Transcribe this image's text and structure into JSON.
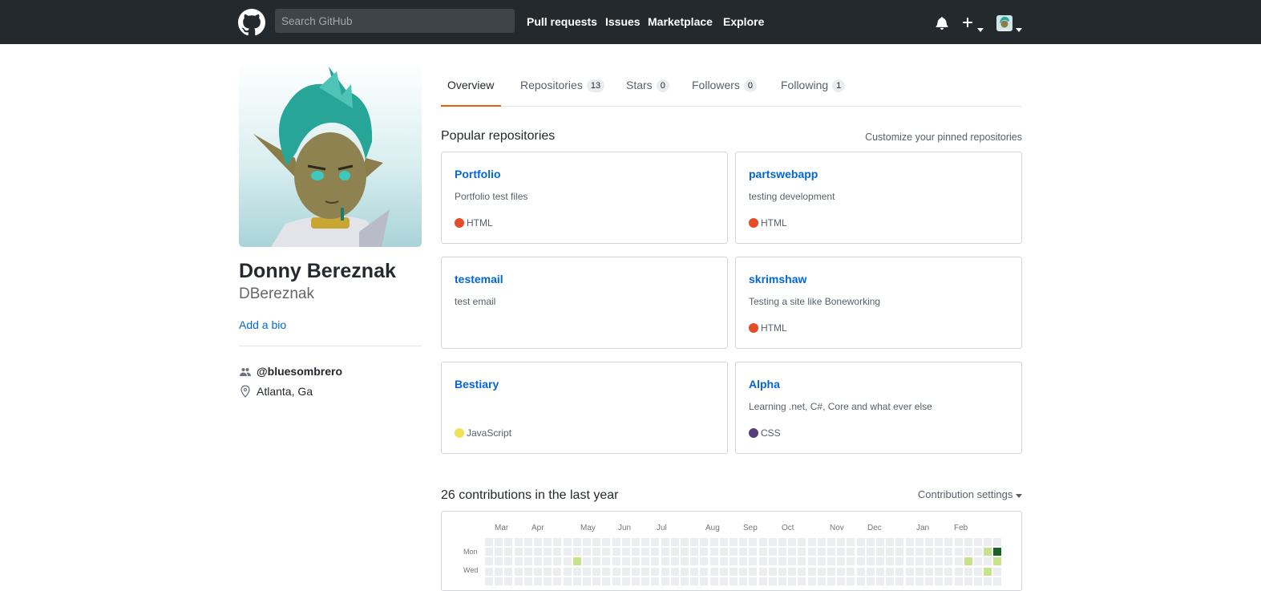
{
  "header": {
    "search_placeholder": "Search GitHub",
    "nav": [
      "Pull requests",
      "Issues",
      "Marketplace",
      "Explore"
    ],
    "icons": [
      "github-logo-icon",
      "bell-icon",
      "plus-icon",
      "chevron-down-icon",
      "avatar"
    ]
  },
  "profile": {
    "fullname": "Donny Bereznak",
    "username": "DBereznak",
    "add_bio": "Add a bio",
    "organization": "@bluesombrero",
    "location": "Atlanta, Ga"
  },
  "tabs": [
    {
      "label": "Overview",
      "count": null,
      "selected": true
    },
    {
      "label": "Repositories",
      "count": "13",
      "selected": false
    },
    {
      "label": "Stars",
      "count": "0",
      "selected": false
    },
    {
      "label": "Followers",
      "count": "0",
      "selected": false
    },
    {
      "label": "Following",
      "count": "1",
      "selected": false
    }
  ],
  "pinned": {
    "title": "Popular repositories",
    "customize": "Customize your pinned repositories",
    "repos": [
      {
        "name": "Portfolio",
        "description": "Portfolio test files",
        "language": "HTML",
        "color": "#e34c26"
      },
      {
        "name": "partswebapp",
        "description": "testing development",
        "language": "HTML",
        "color": "#e34c26"
      },
      {
        "name": "testemail",
        "description": "test email",
        "language": "",
        "color": ""
      },
      {
        "name": "skrimshaw",
        "description": "Testing a site like Boneworking",
        "language": "HTML",
        "color": "#e34c26"
      },
      {
        "name": "Bestiary",
        "description": "",
        "language": "JavaScript",
        "color": "#f1e05a"
      },
      {
        "name": "Alpha",
        "description": "Learning .net, C#, Core and what ever else",
        "language": "CSS",
        "color": "#563d7c"
      }
    ]
  },
  "contributions": {
    "title": "26 contributions in the last year",
    "settings": "Contribution settings",
    "months": [
      "Mar",
      "Apr",
      "May",
      "Jun",
      "Jul",
      "Aug",
      "Sep",
      "Oct",
      "Nov",
      "Dec",
      "Jan",
      "Feb"
    ],
    "weekdays": [
      "Mon",
      "Wed"
    ],
    "colors": {
      "empty": "#ebedf0",
      "level1": "#c6e48b",
      "level4": "#196127"
    },
    "week_count": 53
  }
}
